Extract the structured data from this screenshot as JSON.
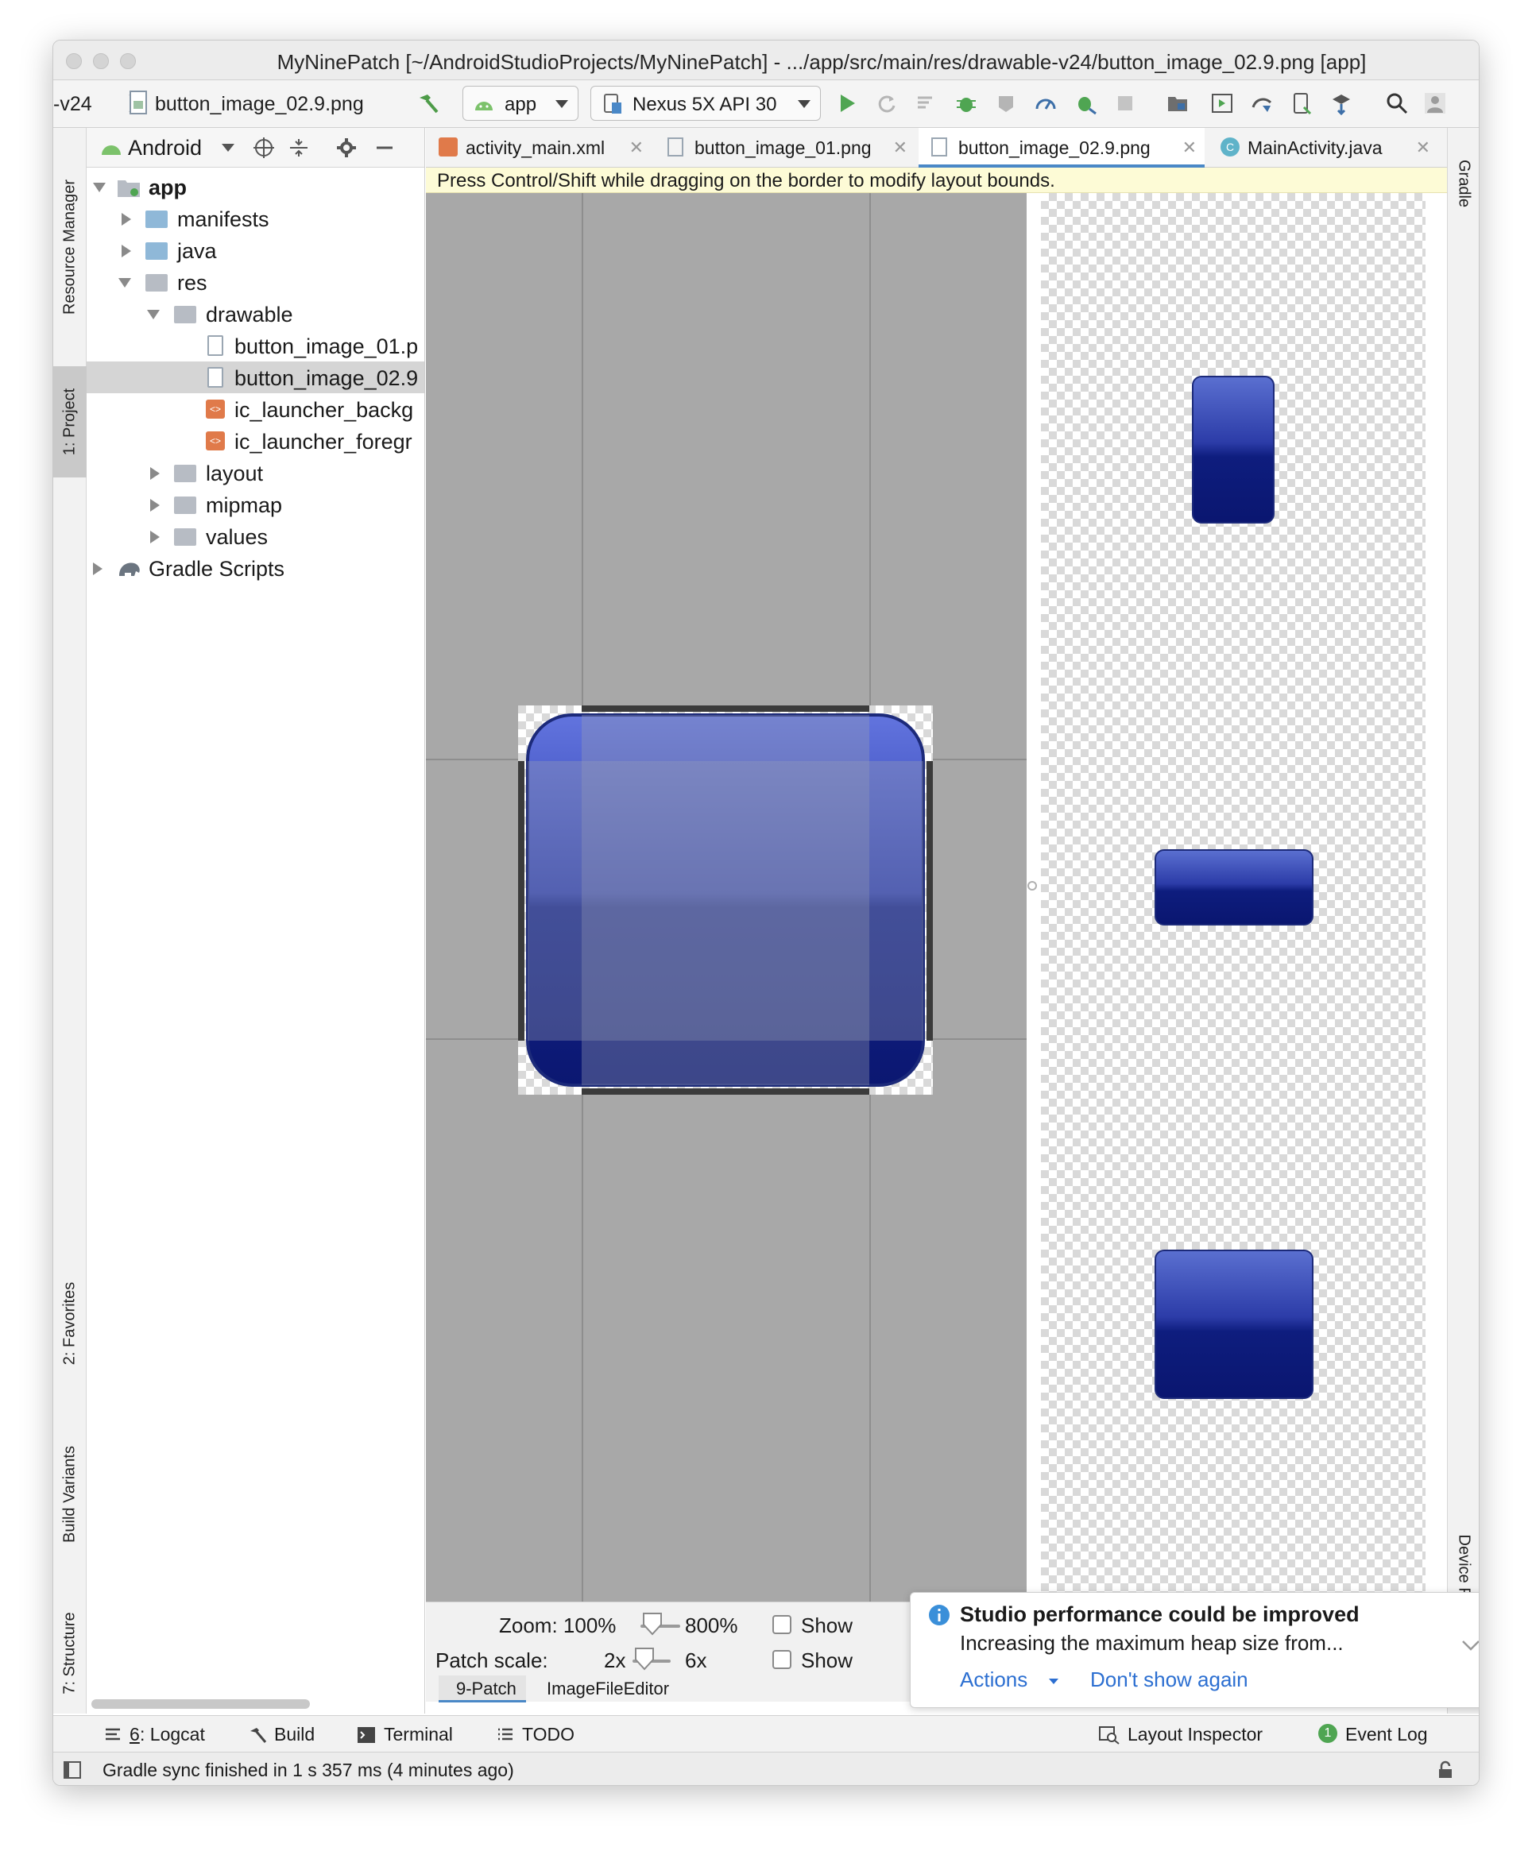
{
  "window": {
    "title": "MyNinePatch [~/AndroidStudioProjects/MyNinePatch] - .../app/src/main/res/drawable-v24/button_image_02.9.png [app]"
  },
  "navbar": {
    "breadcrumb_prev": "-v24",
    "breadcrumb_file": "button_image_02.9.png",
    "config_label": "app",
    "device_label": "Nexus 5X API 30"
  },
  "left_strip": {
    "resource_manager": "Resource Manager",
    "project": "1: Project",
    "favorites": "2: Favorites",
    "build_variants": "Build Variants",
    "structure": "7: Structure"
  },
  "right_strip": {
    "gradle": "Gradle",
    "device_file_explorer": "Device File Explorer"
  },
  "project": {
    "view_mode": "Android",
    "tree": [
      {
        "label": "app",
        "bold": true
      },
      {
        "label": "manifests"
      },
      {
        "label": "java"
      },
      {
        "label": "res"
      },
      {
        "label": "drawable"
      },
      {
        "label": "button_image_01.p"
      },
      {
        "label": "button_image_02.9"
      },
      {
        "label": "ic_launcher_backg"
      },
      {
        "label": "ic_launcher_foregr"
      },
      {
        "label": "layout"
      },
      {
        "label": "mipmap"
      },
      {
        "label": "values"
      },
      {
        "label": "Gradle Scripts"
      }
    ]
  },
  "tabs": [
    {
      "label": "activity_main.xml"
    },
    {
      "label": "button_image_01.png"
    },
    {
      "label": "button_image_02.9.png",
      "active": true
    },
    {
      "label": "MainActivity.java"
    }
  ],
  "hint": "Press Control/Shift while dragging on the border to modify layout bounds.",
  "bottom_panel": {
    "zoom_label": "Zoom: 100%",
    "zoom_max": "800%",
    "patch_scale_label": "Patch scale:",
    "patch_min": "2x",
    "patch_max": "6x",
    "show_1": "Show",
    "show_2": "Show",
    "subtabs": [
      "9-Patch",
      "ImageFileEditor"
    ]
  },
  "notification": {
    "title": "Studio performance could be improved",
    "message": "Increasing the maximum heap size from...",
    "actions": "Actions",
    "dismiss": "Don't show again"
  },
  "tool_windows": {
    "logcat_num": "6",
    "logcat": ": Logcat",
    "build": "Build",
    "terminal": "Terminal",
    "todo": "TODO",
    "layout_inspector": "Layout Inspector",
    "event_log_badge": "1",
    "event_log": "Event Log"
  },
  "status": "Gradle sync finished in 1 s 357 ms (4 minutes ago)",
  "colors": {
    "accent": "#4a88c7",
    "button_blue": "#0e1d7e",
    "link": "#2c6fd1"
  }
}
